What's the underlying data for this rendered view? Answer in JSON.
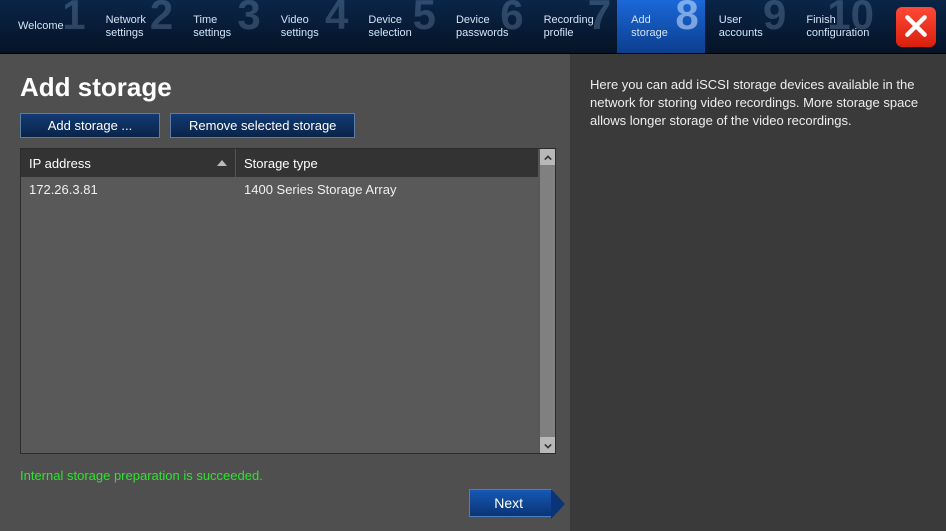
{
  "steps": [
    {
      "num": "1",
      "l1": "Welcome",
      "l2": ""
    },
    {
      "num": "2",
      "l1": "Network",
      "l2": "settings"
    },
    {
      "num": "3",
      "l1": "Time",
      "l2": "settings"
    },
    {
      "num": "4",
      "l1": "Video",
      "l2": "settings"
    },
    {
      "num": "5",
      "l1": "Device",
      "l2": "selection"
    },
    {
      "num": "6",
      "l1": "Device",
      "l2": "passwords"
    },
    {
      "num": "7",
      "l1": "Recording",
      "l2": "profile"
    },
    {
      "num": "8",
      "l1": "Add",
      "l2": "storage"
    },
    {
      "num": "9",
      "l1": "User",
      "l2": "accounts"
    },
    {
      "num": "10",
      "l1": "Finish",
      "l2": "configuration"
    }
  ],
  "active_step_index": 7,
  "page_title": "Add storage",
  "buttons": {
    "add": "Add storage ...",
    "remove": "Remove selected storage",
    "next": "Next"
  },
  "table": {
    "headers": {
      "ip": "IP address",
      "type": "Storage type"
    },
    "rows": [
      {
        "ip": "172.26.3.81",
        "type": "1400 Series Storage Array"
      }
    ]
  },
  "status_text": "Internal storage preparation is succeeded.",
  "help_text": "Here you can add iSCSI storage devices available in the network for storing video recordings. More storage space allows longer storage of the video recordings."
}
